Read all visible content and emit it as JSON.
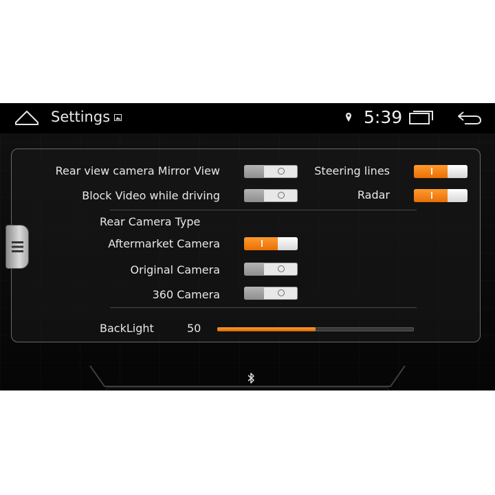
{
  "status_bar": {
    "title": "Settings",
    "time": "5:39",
    "icons": [
      "home-icon",
      "gallery-icon",
      "location-icon",
      "recents-icon",
      "back-icon"
    ]
  },
  "settings": {
    "rear_view_mirror": {
      "label": "Rear view camera Mirror View",
      "on": false
    },
    "block_video": {
      "label": "Block Video while driving",
      "on": false
    },
    "steering_lines": {
      "label": "Steering lines",
      "on": true
    },
    "radar": {
      "label": "Radar",
      "on": true
    },
    "rear_camera_type": {
      "heading": "Rear Camera Type",
      "options": [
        {
          "label": "Aftermarket Camera",
          "on": true
        },
        {
          "label": "Original Camera",
          "on": false
        },
        {
          "label": "360 Camera",
          "on": false
        }
      ]
    },
    "backlight": {
      "label": "BackLight",
      "value": "50",
      "fraction": 0.5
    }
  },
  "colors": {
    "accent": "#f5841a",
    "background": "#0b0b0b",
    "text": "#e8e8e8"
  },
  "dock": {
    "icons": [
      "bluetooth-icon"
    ]
  }
}
